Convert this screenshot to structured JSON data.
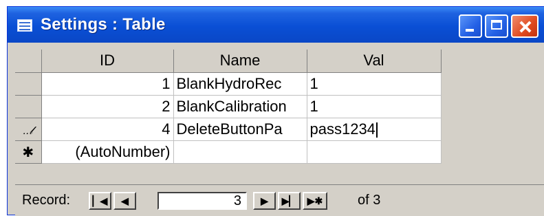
{
  "window": {
    "title": "Settings : Table"
  },
  "grid": {
    "columns": [
      "ID",
      "Name",
      "Val"
    ],
    "rows": [
      {
        "selector": "",
        "id": "1",
        "name": "BlankHydroRec",
        "val": "1"
      },
      {
        "selector": "",
        "id": "2",
        "name": "BlankCalibration",
        "val": "1"
      },
      {
        "selector": "pencil",
        "id": "4",
        "name": "DeleteButtonPa",
        "val": "pass1234"
      },
      {
        "selector": "new",
        "id": "(AutoNumber)",
        "name": "",
        "val": ""
      }
    ]
  },
  "navigator": {
    "label": "Record:",
    "current": "3",
    "total_text": "of  3"
  }
}
